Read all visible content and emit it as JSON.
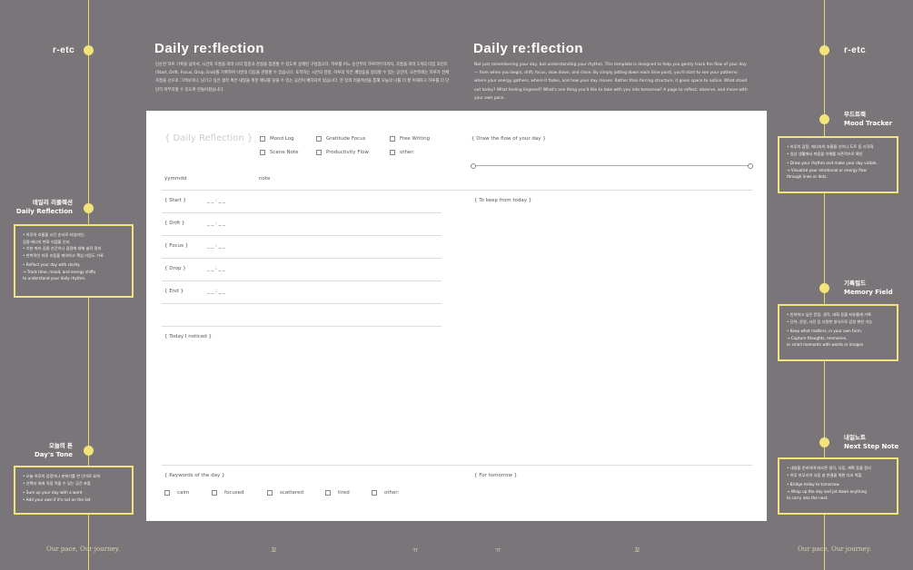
{
  "brand_left": "r-etc",
  "brand_right": "r-etc",
  "header_left": {
    "title": "Daily re:flection",
    "desc": "단순한 하루 기록을 넘어서, 시간의 흐름을 따라 나의 집중과 감정을 점검할 수 있도록 설계된 구성입니다. 하루를 어느 순간부터 하루마무리까지, 흐름을 따라 5개의 타임 포인트 (Start, Drift, Focus, Drop, End)를 기록하며 나만의 리듬을 관찰할 수 있습니다. 포착하는 시간의 감정, 하루의 작은 깨달음을 정리할 수 있는 공간이, 오른쪽에는 하루가 전체 흐름을 선으로 그려보거나, 남기고 싶은 생각 혹은 내일을 위한 메모를 담을 수 있는 공간이 배치되어 있습니다. 한 장의 리플렉션을 통해 오늘의 나를 더 잘 이해하고 하루를 더 단단히 마무리할 수 있도록 만들어졌습니다."
  },
  "header_right": {
    "title": "Daily re:flection",
    "desc": "Not just remembering your day, but understanding your rhythm. This template is designed to help you gently track the flow of your day — from when you begin, drift, focus, slow down, and close. By simply jotting down each time point, you'll start to see your patterns: where your energy gathers, where it fades, and how your day moves. Rather than forcing structure, it gives space to notice. What stood out today? What feeling lingered? What's one thing you'd like to take with you into tomorrow? A page to reflect, observe, and move with your own pace."
  },
  "left_sections": [
    {
      "title_ko": "데일리 리플렉션",
      "title_en": "Daily Reflection",
      "ko_lines": [
        "• 하루의 흐름을 시간 순서로 타임라인,",
        "  집중·에너지 변화 지점을 인지",
        "• 기분 따라 집중 순간이나 감정에 대해 솔직 정리",
        "• 반복적인 하루 리듬을 파악하고 핵심 리듬도 기록"
      ],
      "en_lines": [
        "• Reflect your day with clarity.",
        "→ Track time, mood, and energy shifts",
        "to understand your daily rhythm."
      ]
    },
    {
      "title_ko": "오늘의 톤",
      "title_en": "Day's Tone",
      "ko_lines": [
        "• 오늘 하루의 감정이나 분위기를 한 단어로 요약",
        "• 선택지 외에 직접 적을 수 있는 공간 포함"
      ],
      "en_lines": [
        "• Sum up your day with a word",
        "• Add your own if it's not on the list"
      ]
    }
  ],
  "right_sections": [
    {
      "title_ko": "무드트랙",
      "title_en": "Mood Tracker",
      "ko_lines": [
        "• 하루의 감정, 에너지의 흐름을 선이나 도트 등 시각화",
        "• 일상 생활에서 마음을 이해를 자존적으로 확인"
      ],
      "en_lines": [
        "• Draw your rhythm and make your day visible.",
        "→ Visualize your emotional or energy flow",
        "through lines or dots."
      ]
    },
    {
      "title_ko": "기록필드",
      "title_en": "Memory Field",
      "ko_lines": [
        "• 인하하고 싶은 문장, 생각, 대화 등을 자유롭게 기록",
        "• 단어, 문장, 사진 등 다양한 방식으로 감정 위한 기능"
      ],
      "en_lines": [
        "• Keep what matters, in your own form.",
        "→ Capture thoughts, memories,",
        "or small moments with words or images."
      ]
    },
    {
      "title_ko": "내일노트",
      "title_en": "Next Step Note",
      "ko_lines": [
        "• 내일을 준비하며 떠오른 생각, 다짐, 계획 등을 정리",
        "• 하루 마무리의 다음 날 연결을 위한 다리 역할"
      ],
      "en_lines": [
        "• Bridge today to tomorrow.",
        "→ Wrap up the day and jot down anything",
        "to carry into the next."
      ]
    }
  ],
  "sheet": {
    "title": "{ Daily Reflection }",
    "checkbox_col1": [
      "Mood Log",
      "Scene Note"
    ],
    "checkbox_col2": [
      "Gratitude Focus",
      "Productivity Flow"
    ],
    "checkbox_col3": [
      "Free Writing",
      "other:"
    ],
    "flow_label": "{ Draw the flow of your day }",
    "date_label": "yymmdd",
    "note_label": "note",
    "times": [
      {
        "label": "{ Start }",
        "value": "_ _ : _ _"
      },
      {
        "label": "{ Drift }",
        "value": "_ _ : _ _"
      },
      {
        "label": "{ Focus }",
        "value": "_ _ : _ _"
      },
      {
        "label": "{ Drop }",
        "value": "_ _ : _ _"
      },
      {
        "label": "{ End }",
        "value": "_ _ : _ _"
      }
    ],
    "keep_label": "{ To keep from today }",
    "noticed_label": "{ Today I noticed }",
    "keywords_label": "{ Keywords of the day }",
    "keywords": [
      "calm",
      "focused",
      "scattered",
      "tired",
      "other:"
    ],
    "tomorrow_label": "{ For tomorrow }"
  },
  "footer": {
    "left": "Our pace, Our journey.",
    "right": "Our pace, Our journey.",
    "marks": [
      "꼬",
      "ㅠ",
      "ㅠ",
      "꼬"
    ]
  }
}
